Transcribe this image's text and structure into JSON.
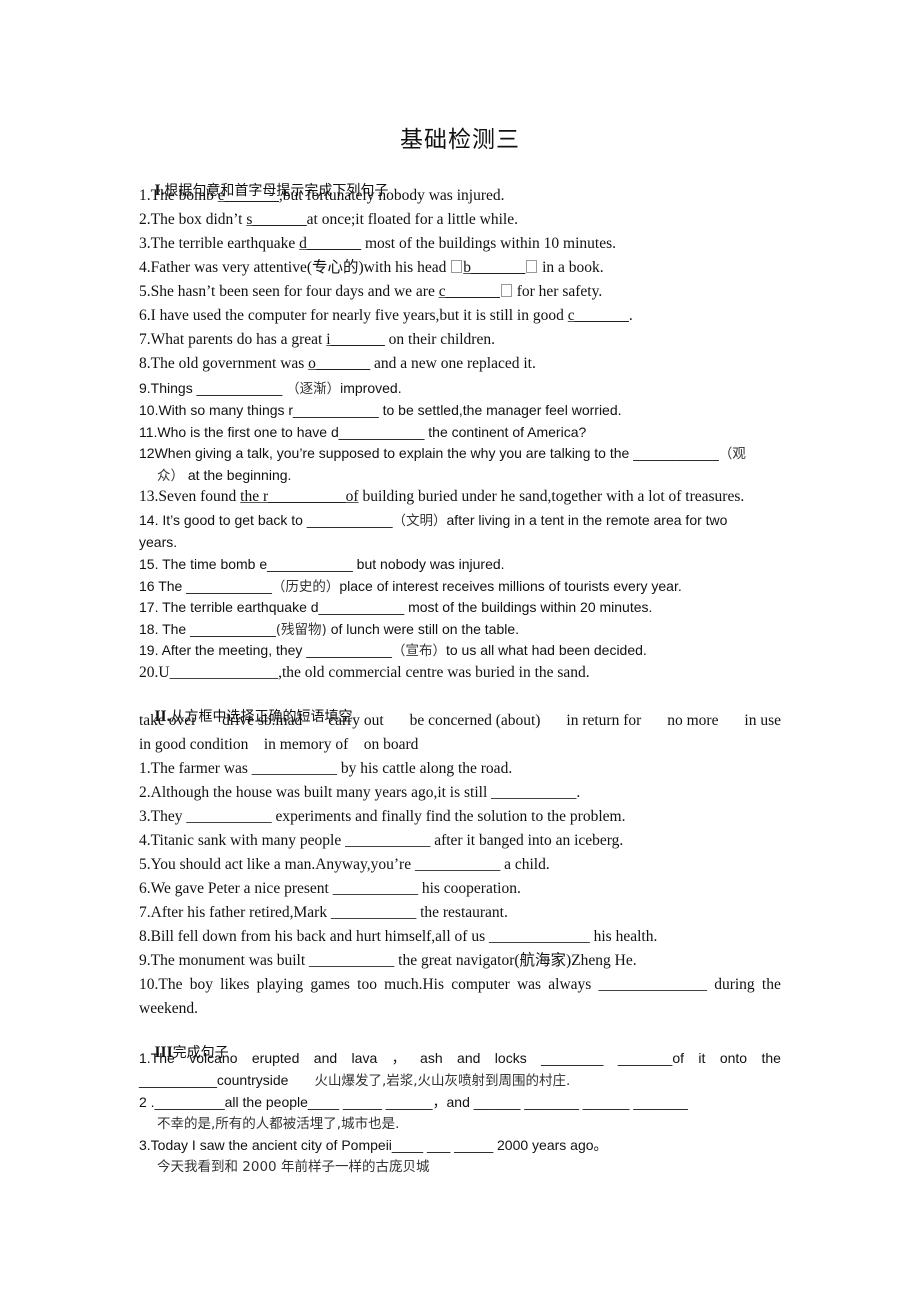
{
  "title": "基础检测三",
  "section1": {
    "heading_num": "I.",
    "heading_text": "根据句意和首字母提示完成下列句子",
    "items": [
      {
        "pre": "1.The bomb ",
        "blank": "e_______",
        "post": ",but fortunately nobody was injured."
      },
      {
        "pre": "2.The box didn’t ",
        "blank": "s_______",
        "post": "at once;it floated for a little while."
      },
      {
        "pre": "3.The terrible earthquake ",
        "blank": "d_______",
        "post": " most of the buildings within 10 minutes."
      },
      {
        "pre": "4.Father was very attentive(专心的)with his head ",
        "blank": "b_______",
        "post": " in a book."
      },
      {
        "pre": "5.She hasn’t been seen for four days and we are ",
        "blank": "c_______",
        "post": " for her safety."
      },
      {
        "pre": "6.I have used the computer for nearly five years,but it is still in good ",
        "blank": "c_______",
        "post": "."
      },
      {
        "pre": "7.What parents do has a great ",
        "blank": "i_______",
        "post": " on their children."
      },
      {
        "pre": "8.The old government was ",
        "blank": "o_______",
        "post": " and a new one replaced it."
      },
      {
        "pre": "9.Things ___________ ",
        "cn": "（逐渐）",
        "post": "improved."
      },
      {
        "text": "10.With so many things r___________ to be settled,the manager feel worried."
      },
      {
        "text": "11.Who is the first one to have d___________ the continent of America?"
      },
      {
        "pre": "12When giving a talk, you’re supposed to explain the why you are talking to the ___________",
        "cn": "（观",
        "cont_cn": "众）",
        "cont": " at the beginning."
      },
      {
        "pre": "13.Seven found ",
        "blank": "the r__________of",
        "post": " building buried under he sand,together with a lot of treasures."
      },
      {
        "pre": "14. It’s good to get back to ___________",
        "cn": "（文明）",
        "post": "after living in a tent in the remote area for two",
        "cont": "years."
      },
      {
        "text": "15. The time bomb e___________ but nobody was injured."
      },
      {
        "pre": "16 The ___________",
        "cn": "（历史的）",
        "post": "place of interest receives millions of tourists every year."
      },
      {
        "text": "17. The terrible earthquake d___________ most of the buildings within 20 minutes."
      },
      {
        "pre": "18. The ___________",
        "cn": "(残留物)",
        "post": " of lunch were still on the table."
      },
      {
        "pre": "19. After the meeting, they ___________",
        "cn": "（宣布）",
        "post": "to us all what had been decided."
      },
      {
        "text": "20.U______________,the old commercial centre was buried in the sand."
      }
    ]
  },
  "section2": {
    "heading_num": "II.",
    "heading_text": "从方框中选择正确的短语填空",
    "phrases_row1": [
      "take over",
      "drive sb.mad",
      "carry out",
      "be concerned (about)",
      "in return for",
      "no more",
      "in use"
    ],
    "phrases_row2": "in good condition    in memory of    on board",
    "items": [
      "1.The farmer was ___________ by his cattle along the road.",
      "2.Although the house was built many years ago,it is still ___________.",
      "3.They ___________ experiments and finally find the solution to the problem.",
      "4.Titanic sank with many people ___________ after it banged into an iceberg.",
      "5.You should act like a man.Anyway,you’re ___________ a child.",
      "6.We gave Peter a nice present ___________ his cooperation.",
      "7.After his father retired,Mark ___________ the restaurant.",
      "8.Bill fell down from his back and hurt himself,all of us _____________ his health.",
      "9.The monument was built ___________ the great navigator(航海家)Zheng He."
    ],
    "item10": {
      "words": [
        "10.The",
        "boy",
        "likes",
        "playing",
        "games",
        "too",
        "much.His",
        "computer",
        "was",
        "always",
        "______________",
        "during",
        "the"
      ],
      "cont": "weekend."
    }
  },
  "section3": {
    "heading_num": "III",
    "heading_text": "完成句子",
    "item1_words": [
      "1.The",
      "volcano",
      "erupted",
      "and",
      "lava",
      "，",
      "ash",
      "and",
      "locks",
      "________",
      "_______of",
      "it",
      "onto",
      "the"
    ],
    "item1_cont": "__________countryside",
    "item1_cn": "火山爆发了,岩浆,火山灰喷射到周围的村庄.",
    "item2": "2 ._________all the people____ _____ ______，and ______ _______ ______ _______",
    "item2_cn": "不幸的是,所有的人都被活埋了,城市也是.",
    "item3": "3.Today I saw the ancient city of Pompeii____ ___ _____ 2000 years ago。",
    "item3_cn": "今天我看到和 2000 年前样子一样的古庞贝城"
  }
}
